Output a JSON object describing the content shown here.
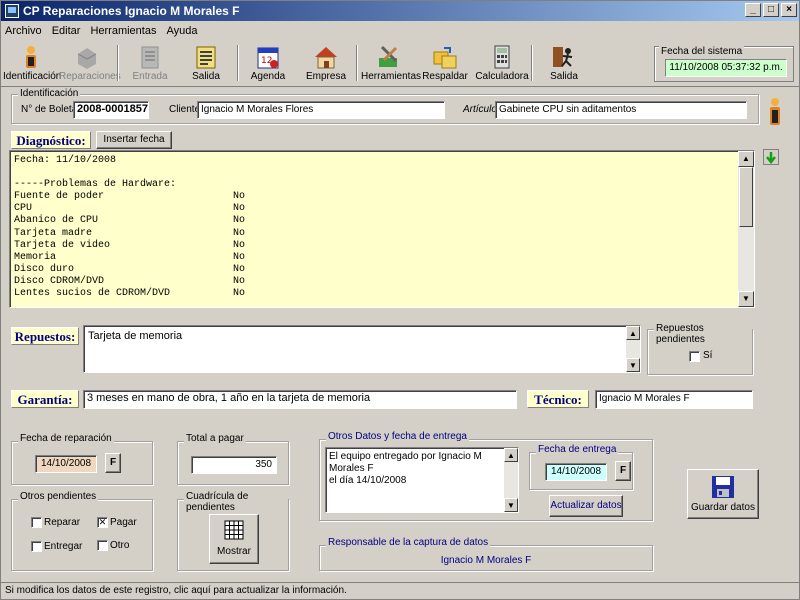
{
  "window": {
    "title": "CP Reparaciones Ignacio M Morales F",
    "min": "_",
    "max": "□",
    "close": "×"
  },
  "menu": [
    "Archivo",
    "Editar",
    "Herramientas",
    "Ayuda"
  ],
  "toolbar": [
    {
      "label": "Identificación",
      "icon": "person-icon",
      "enabled": true
    },
    {
      "label": "Reparaciones",
      "icon": "box-icon",
      "enabled": false
    },
    {
      "label": "Entrada",
      "icon": "clipboard-icon",
      "enabled": false
    },
    {
      "label": "Salida",
      "icon": "clipboard-check-icon",
      "enabled": true
    },
    {
      "label": "Agenda",
      "icon": "calendar-icon",
      "enabled": true
    },
    {
      "label": "Empresa",
      "icon": "house-icon",
      "enabled": true
    },
    {
      "label": "Herramientas",
      "icon": "tools-icon",
      "enabled": true
    },
    {
      "label": "Respaldar",
      "icon": "backup-icon",
      "enabled": true
    },
    {
      "label": "Calculadora",
      "icon": "calculator-icon",
      "enabled": true
    },
    {
      "label": "Salida",
      "icon": "exit-icon",
      "enabled": true
    }
  ],
  "system_date": {
    "caption": "Fecha del sistema",
    "value": "11/10/2008 05:37:32 p.m."
  },
  "identificacion": {
    "caption": "Identificación",
    "boleta_label": "N° de Boleta:",
    "boleta_value": "2008-0001857",
    "cliente_label": "Cliente:",
    "cliente_value": "Ignacio M Morales Flores",
    "articulo_label": "Artículo:",
    "articulo_value": "Gabinete CPU sin aditamentos"
  },
  "diagnostico": {
    "label": "Diagnóstico:",
    "insert_date_button": "Insertar fecha",
    "lines": [
      {
        "k": "Fecha: 11/10/2008",
        "v": ""
      },
      {
        "k": "",
        "v": ""
      },
      {
        "k": "-----Problemas de Hardware:",
        "v": ""
      },
      {
        "k": "Fuente de poder",
        "v": "No"
      },
      {
        "k": "CPU",
        "v": "No"
      },
      {
        "k": "Abanico de CPU",
        "v": "No"
      },
      {
        "k": "Tarjeta madre",
        "v": "No"
      },
      {
        "k": "Tarjeta de video",
        "v": "No"
      },
      {
        "k": "Memoria",
        "v": "No"
      },
      {
        "k": "Disco duro",
        "v": "No"
      },
      {
        "k": "Disco CDROM/DVD",
        "v": "No"
      },
      {
        "k": "Lentes sucios de CDROM/DVD",
        "v": "No"
      }
    ]
  },
  "repuestos": {
    "label": "Repuestos:",
    "value": "Tarjeta de memoria",
    "pending_caption": "Repuestos pendientes",
    "pending_checkbox": "Sí",
    "pending_checked": false
  },
  "garantia": {
    "label": "Garantía:",
    "value": "3 meses en mano de obra, 1 año en la tarjeta de memoria"
  },
  "tecnico": {
    "label": "Técnico:",
    "value": "Ignacio M Morales F"
  },
  "fecha_reparacion": {
    "caption": "Fecha de reparación",
    "value": "14/10/2008",
    "button": "F",
    "color": "#f0d8c0"
  },
  "total": {
    "caption": "Total a pagar",
    "value": "350"
  },
  "otros_pendientes": {
    "caption": "Otros pendientes",
    "items": [
      {
        "label": "Reparar",
        "checked": false
      },
      {
        "label": "Pagar",
        "checked": true
      },
      {
        "label": "Entregar",
        "checked": false
      },
      {
        "label": "Otro",
        "checked": false
      }
    ]
  },
  "cuadricula": {
    "caption": "Cuadrícula de pendientes",
    "button": "Mostrar",
    "icon": "grid-icon"
  },
  "otros_datos": {
    "caption": "Otros Datos y fecha de entrega",
    "text_line1": "El equipo entregado por Ignacio M Morales F",
    "text_line2": "el día 14/10/2008",
    "entrega_caption": "Fecha de entrega",
    "entrega_value": "14/10/2008",
    "entrega_button": "F",
    "entrega_color": "#ccffff",
    "update_button": "Actualizar datos"
  },
  "guardar": {
    "label": "Guardar datos",
    "icon": "floppy-disk-icon"
  },
  "responsable": {
    "caption": "Responsable de la captura de datos",
    "value": "Ignacio M Morales F"
  },
  "status": "Si modifica los datos de este registro, clic aquí para actualizar la información.",
  "colors": {
    "diag_bg": "#ffffcc",
    "section_label": "#000080",
    "sysdate_bg": "#ccffcc",
    "titlebar": "#0a246a"
  }
}
